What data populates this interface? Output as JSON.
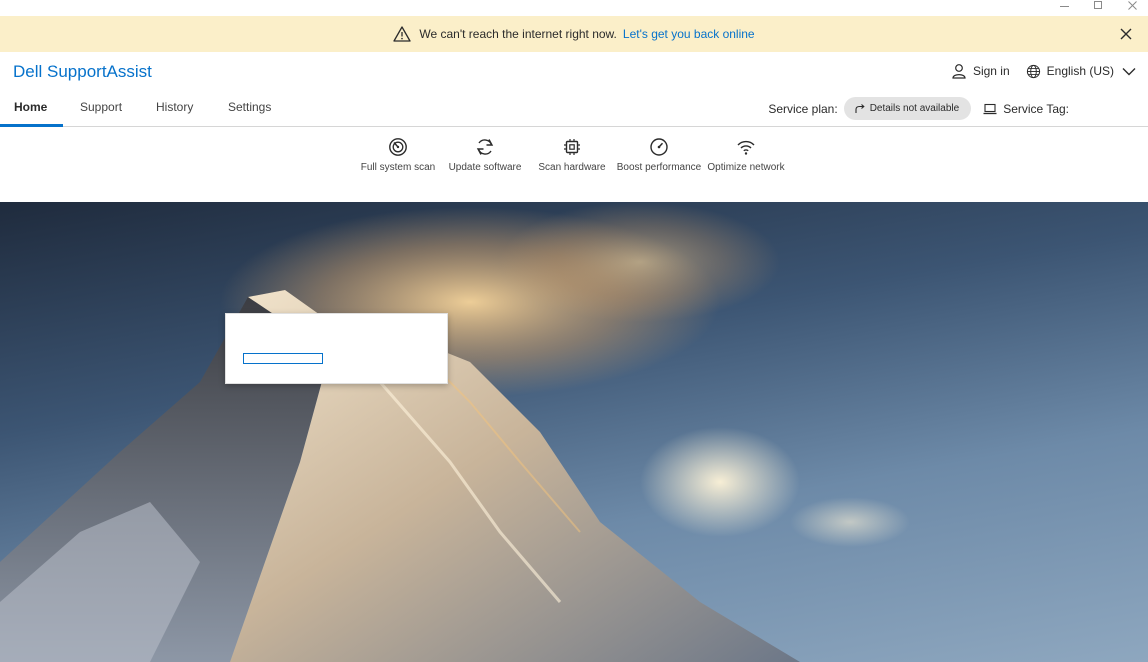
{
  "window": {
    "controls": [
      "minimize-icon",
      "maximize-icon",
      "close-icon"
    ]
  },
  "banner": {
    "message": "We can't reach the internet right now.",
    "link": "Let's get you back online",
    "icon": "warning-icon",
    "background": "#fbefc9"
  },
  "header": {
    "title": "Dell SupportAssist",
    "sign_in": "Sign in",
    "language": "English (US)",
    "accent": "#0672cb"
  },
  "nav": {
    "tabs": [
      {
        "label": "Home",
        "active": true
      },
      {
        "label": "Support",
        "active": false
      },
      {
        "label": "History",
        "active": false
      },
      {
        "label": "Settings",
        "active": false
      }
    ],
    "service_plan_label": "Service plan:",
    "service_plan_value": "Details not available",
    "service_tag_label": "Service Tag:"
  },
  "actions": [
    {
      "label": "Full system scan",
      "icon": "scan-icon"
    },
    {
      "label": "Update software",
      "icon": "refresh-icon"
    },
    {
      "label": "Scan hardware",
      "icon": "chip-icon"
    },
    {
      "label": "Boost performance",
      "icon": "gauge-icon"
    },
    {
      "label": "Optimize network",
      "icon": "wifi-icon"
    }
  ]
}
